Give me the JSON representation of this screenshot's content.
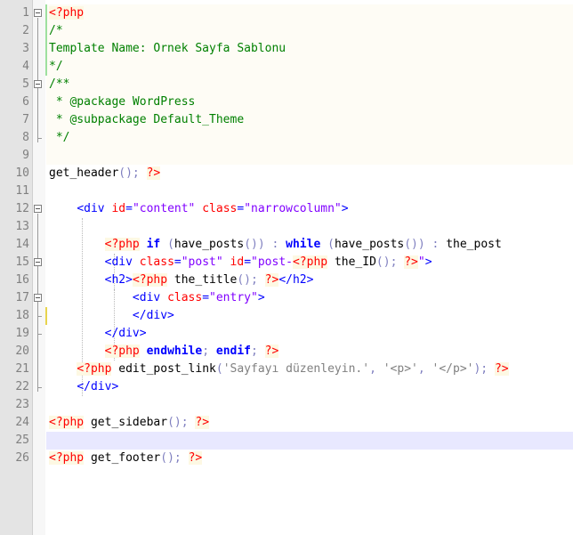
{
  "editor": {
    "lines": [
      {
        "n": "1",
        "fold": "start",
        "tokens": [
          {
            "t": "<?php",
            "c": "tag"
          }
        ]
      },
      {
        "n": "2",
        "tokens": [
          {
            "t": "/*",
            "c": "cmt"
          }
        ]
      },
      {
        "n": "3",
        "tokens": [
          {
            "t": "Template Name: Ornek Sayfa Sablonu",
            "c": "cmt"
          }
        ]
      },
      {
        "n": "4",
        "tokens": [
          {
            "t": "*/",
            "c": "cmt"
          }
        ]
      },
      {
        "n": "5",
        "fold": "start",
        "tokens": [
          {
            "t": "/**",
            "c": "cmt"
          }
        ]
      },
      {
        "n": "6",
        "tokens": [
          {
            "t": " * @package WordPress",
            "c": "cmt"
          }
        ]
      },
      {
        "n": "7",
        "tokens": [
          {
            "t": " * @subpackage Default_Theme",
            "c": "cmt"
          }
        ]
      },
      {
        "n": "8",
        "tokens": [
          {
            "t": " */",
            "c": "cmt"
          }
        ]
      },
      {
        "n": "9",
        "tokens": []
      },
      {
        "n": "10",
        "tokens": [
          {
            "t": "get_header",
            "c": "plain"
          },
          {
            "t": "();",
            "c": "op"
          },
          {
            "t": " ",
            "c": "plain"
          },
          {
            "t": "?>",
            "c": "tag"
          }
        ]
      },
      {
        "n": "11",
        "tokens": []
      },
      {
        "n": "12",
        "fold": "start",
        "tokens": [
          {
            "t": "    ",
            "c": "plain"
          },
          {
            "t": "<div",
            "c": "html"
          },
          {
            "t": " ",
            "c": "plain"
          },
          {
            "t": "id",
            "c": "attr"
          },
          {
            "t": "=",
            "c": "html"
          },
          {
            "t": "\"content\"",
            "c": "val"
          },
          {
            "t": " ",
            "c": "plain"
          },
          {
            "t": "class",
            "c": "attr"
          },
          {
            "t": "=",
            "c": "html"
          },
          {
            "t": "\"narrowcolumn\"",
            "c": "val"
          },
          {
            "t": ">",
            "c": "html"
          }
        ]
      },
      {
        "n": "13",
        "tokens": []
      },
      {
        "n": "14",
        "tokens": [
          {
            "t": "        ",
            "c": "plain"
          },
          {
            "t": "<?php",
            "c": "tag"
          },
          {
            "t": " ",
            "c": "plain"
          },
          {
            "t": "if",
            "c": "kw"
          },
          {
            "t": " (",
            "c": "op"
          },
          {
            "t": "have_posts",
            "c": "plain"
          },
          {
            "t": "())",
            "c": "op"
          },
          {
            "t": " : ",
            "c": "op"
          },
          {
            "t": "while",
            "c": "kw"
          },
          {
            "t": " (",
            "c": "op"
          },
          {
            "t": "have_posts",
            "c": "plain"
          },
          {
            "t": "())",
            "c": "op"
          },
          {
            "t": " : ",
            "c": "op"
          },
          {
            "t": "the_post",
            "c": "plain"
          }
        ]
      },
      {
        "n": "15",
        "fold": "start",
        "tokens": [
          {
            "t": "        ",
            "c": "plain"
          },
          {
            "t": "<div",
            "c": "html"
          },
          {
            "t": " ",
            "c": "plain"
          },
          {
            "t": "class",
            "c": "attr"
          },
          {
            "t": "=",
            "c": "html"
          },
          {
            "t": "\"post\"",
            "c": "val"
          },
          {
            "t": " ",
            "c": "plain"
          },
          {
            "t": "id",
            "c": "attr"
          },
          {
            "t": "=",
            "c": "html"
          },
          {
            "t": "\"post-",
            "c": "val"
          },
          {
            "t": "<?php",
            "c": "tag"
          },
          {
            "t": " ",
            "c": "plain"
          },
          {
            "t": "the_ID",
            "c": "plain"
          },
          {
            "t": "();",
            "c": "op"
          },
          {
            "t": " ",
            "c": "plain"
          },
          {
            "t": "?>",
            "c": "tag"
          },
          {
            "t": "\"",
            "c": "val"
          },
          {
            "t": ">",
            "c": "html"
          }
        ]
      },
      {
        "n": "16",
        "tokens": [
          {
            "t": "        ",
            "c": "plain"
          },
          {
            "t": "<h2>",
            "c": "html"
          },
          {
            "t": "<?php",
            "c": "tag"
          },
          {
            "t": " ",
            "c": "plain"
          },
          {
            "t": "the_title",
            "c": "plain"
          },
          {
            "t": "();",
            "c": "op"
          },
          {
            "t": " ",
            "c": "plain"
          },
          {
            "t": "?>",
            "c": "tag"
          },
          {
            "t": "</h2>",
            "c": "html"
          }
        ]
      },
      {
        "n": "17",
        "fold": "start",
        "tokens": [
          {
            "t": "            ",
            "c": "plain"
          },
          {
            "t": "<div",
            "c": "html"
          },
          {
            "t": " ",
            "c": "plain"
          },
          {
            "t": "class",
            "c": "attr"
          },
          {
            "t": "=",
            "c": "html"
          },
          {
            "t": "\"entry\"",
            "c": "val"
          },
          {
            "t": ">",
            "c": "html"
          }
        ]
      },
      {
        "n": "18",
        "tokens": [
          {
            "t": "            ",
            "c": "plain"
          },
          {
            "t": "</div>",
            "c": "html"
          }
        ]
      },
      {
        "n": "19",
        "tokens": [
          {
            "t": "        ",
            "c": "plain"
          },
          {
            "t": "</div>",
            "c": "html"
          }
        ]
      },
      {
        "n": "20",
        "tokens": [
          {
            "t": "        ",
            "c": "plain"
          },
          {
            "t": "<?php",
            "c": "tag"
          },
          {
            "t": " ",
            "c": "plain"
          },
          {
            "t": "endwhile",
            "c": "kw"
          },
          {
            "t": ";",
            "c": "op"
          },
          {
            "t": " ",
            "c": "plain"
          },
          {
            "t": "endif",
            "c": "kw"
          },
          {
            "t": ";",
            "c": "op"
          },
          {
            "t": " ",
            "c": "plain"
          },
          {
            "t": "?>",
            "c": "tag"
          }
        ]
      },
      {
        "n": "21",
        "tokens": [
          {
            "t": "    ",
            "c": "plain"
          },
          {
            "t": "<?php",
            "c": "tag"
          },
          {
            "t": " ",
            "c": "plain"
          },
          {
            "t": "edit_post_link",
            "c": "plain"
          },
          {
            "t": "(",
            "c": "op"
          },
          {
            "t": "'Sayfayı düzenleyin.'",
            "c": "str"
          },
          {
            "t": ", ",
            "c": "op"
          },
          {
            "t": "'<p>'",
            "c": "str"
          },
          {
            "t": ", ",
            "c": "op"
          },
          {
            "t": "'</p>'",
            "c": "str"
          },
          {
            "t": ");",
            "c": "op"
          },
          {
            "t": " ",
            "c": "plain"
          },
          {
            "t": "?>",
            "c": "tag"
          }
        ]
      },
      {
        "n": "22",
        "tokens": [
          {
            "t": "    ",
            "c": "plain"
          },
          {
            "t": "</div>",
            "c": "html"
          }
        ]
      },
      {
        "n": "23",
        "tokens": []
      },
      {
        "n": "24",
        "tokens": [
          {
            "t": "<?php",
            "c": "tag"
          },
          {
            "t": " ",
            "c": "plain"
          },
          {
            "t": "get_sidebar",
            "c": "plain"
          },
          {
            "t": "();",
            "c": "op"
          },
          {
            "t": " ",
            "c": "plain"
          },
          {
            "t": "?>",
            "c": "tag"
          }
        ]
      },
      {
        "n": "25",
        "tokens": []
      },
      {
        "n": "26",
        "tokens": [
          {
            "t": "<?php",
            "c": "tag"
          },
          {
            "t": " ",
            "c": "plain"
          },
          {
            "t": "get_footer",
            "c": "plain"
          },
          {
            "t": "();",
            "c": "op"
          },
          {
            "t": " ",
            "c": "plain"
          },
          {
            "t": "?>",
            "c": "tag"
          }
        ]
      }
    ],
    "colors": {
      "gutter": "#e4e4e4",
      "php_block_background": "#fefcf5",
      "current_line": "#e8e8ff",
      "php_tag": "#ff0000",
      "comment": "#008000",
      "html_tag": "#0000ff",
      "attribute_value": "#8000ff",
      "keyword": "#0000ff",
      "string": "#808080"
    },
    "current_line": "25"
  }
}
